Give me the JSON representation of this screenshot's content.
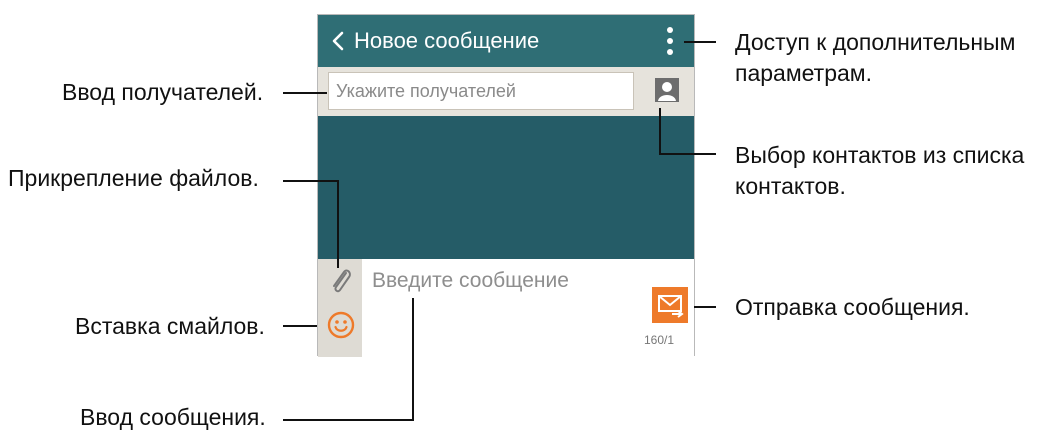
{
  "appbar": {
    "title": "Новое сообщение"
  },
  "recipient": {
    "placeholder": "Укажите получателей"
  },
  "composer": {
    "placeholder": "Введите сообщение",
    "counter": "160/1"
  },
  "callouts": {
    "recipients": "Ввод получателей.",
    "attach": "Прикрепление файлов.",
    "emoji": "Вставка смайлов.",
    "message": "Ввод сообщения.",
    "more_line1": "Доступ к дополнительным",
    "more_line2": "параметрам.",
    "contacts_line1": "Выбор контактов из списка",
    "contacts_line2": "контактов.",
    "send": "Отправка сообщения."
  },
  "colors": {
    "appbar": "#2f6e75",
    "canvas": "#255c67",
    "accent": "#ee7a2a",
    "strip": "#dedbd4"
  },
  "icons": [
    "back-arrow-icon",
    "more-options-icon",
    "contacts-icon",
    "paperclip-icon",
    "smiley-icon",
    "send-envelope-icon"
  ]
}
